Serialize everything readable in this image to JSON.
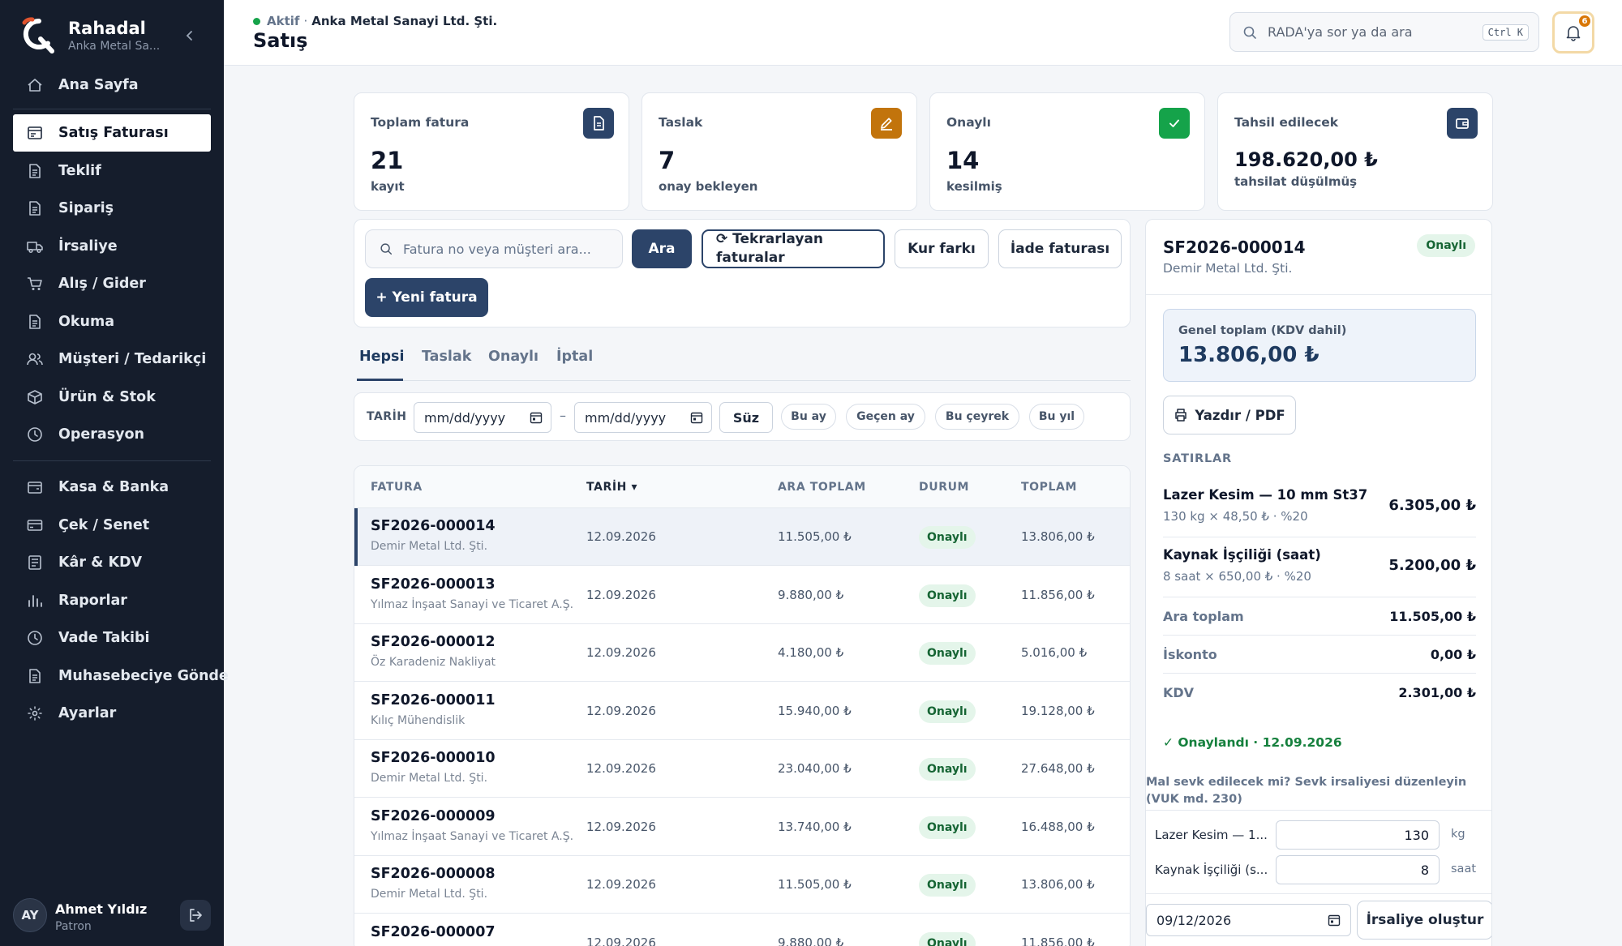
{
  "brand": {
    "name": "Rahadal",
    "subtitle": "Anka Metal Sa..."
  },
  "sidebar": {
    "items": [
      {
        "label": "Ana Sayfa",
        "icon": "home-icon"
      },
      {
        "label": "Satış Faturası",
        "icon": "invoice-icon",
        "active": true
      },
      {
        "label": "Teklif",
        "icon": "document-icon"
      },
      {
        "label": "Sipariş",
        "icon": "document-icon"
      },
      {
        "label": "İrsaliye",
        "icon": "truck-icon"
      },
      {
        "label": "Alış / Gider",
        "icon": "cart-icon"
      },
      {
        "label": "Okuma",
        "icon": "document-icon"
      },
      {
        "label": "Müşteri / Tedarikçi",
        "icon": "users-icon"
      },
      {
        "label": "Ürün & Stok",
        "icon": "box-icon"
      },
      {
        "label": "Operasyon",
        "icon": "clock-icon"
      },
      {
        "label": "Kasa & Banka",
        "icon": "cashbox-icon"
      },
      {
        "label": "Çek / Senet",
        "icon": "card-icon"
      },
      {
        "label": "Kâr & KDV",
        "icon": "ledger-icon"
      },
      {
        "label": "Raporlar",
        "icon": "bar-chart-icon"
      },
      {
        "label": "Vade Takibi",
        "icon": "clock-icon"
      },
      {
        "label": "Muhasebeciye Gönde",
        "icon": "document-icon"
      },
      {
        "label": "Ayarlar",
        "icon": "sun-gear-icon"
      }
    ]
  },
  "user": {
    "initials": "AY",
    "name": "Ahmet Yıldız",
    "role": "Patron"
  },
  "header": {
    "status": "Aktif",
    "separator": "·",
    "company": "Anka Metal Sanayi Ltd. Şti.",
    "title": "Satış",
    "search_placeholder": "RADA'ya sor ya da ara",
    "shortcut": "Ctrl K",
    "notification_count": "6"
  },
  "stats": [
    {
      "label": "Toplam fatura",
      "value": "21",
      "sub": "kayıt",
      "color": "#2c4469",
      "icon": "file-icon"
    },
    {
      "label": "Taslak",
      "value": "7",
      "sub": "onay bekleyen",
      "color": "#c2740c",
      "icon": "pencil-icon"
    },
    {
      "label": "Onaylı",
      "value": "14",
      "sub": "kesilmiş",
      "color": "#15a34a",
      "icon": "check-icon"
    },
    {
      "label": "Tahsil edilecek",
      "value": "198.620,00 ₺",
      "sub": "tahsilat düşülmüş",
      "color": "#2c4469",
      "icon": "wallet-icon"
    }
  ],
  "toolbar": {
    "search_placeholder": "Fatura no veya müşteri ara...",
    "search_button": "Ara",
    "recurring_line1": "⟳ Tekrarlayan",
    "recurring_line2": "faturalar",
    "fx_button": "Kur farkı",
    "return_button": "İade faturası",
    "new_button": "+ Yeni fatura"
  },
  "tabs": [
    "Hepsi",
    "Taslak",
    "Onaylı",
    "İptal"
  ],
  "filter": {
    "label": "TARİH",
    "date_placeholder": "mm/dd/yyyy",
    "dash": "–",
    "apply": "Süz",
    "chips": [
      "Bu ay",
      "Geçen ay",
      "Bu çeyrek",
      "Bu yıl"
    ]
  },
  "table": {
    "columns": [
      "FATURA",
      "TARİH ▾",
      "ARA TOPLAM",
      "DURUM",
      "TOPLAM"
    ],
    "rows": [
      {
        "no": "SF2026-000014",
        "customer": "Demir Metal Ltd. Şti.",
        "date": "12.09.2026",
        "subtotal": "11.505,00 ₺",
        "status": "Onaylı",
        "total": "13.806,00 ₺"
      },
      {
        "no": "SF2026-000013",
        "customer": "Yılmaz İnşaat Sanayi ve Ticaret A.Ş.",
        "date": "12.09.2026",
        "subtotal": "9.880,00 ₺",
        "status": "Onaylı",
        "total": "11.856,00 ₺"
      },
      {
        "no": "SF2026-000012",
        "customer": "Öz Karadeniz Nakliyat",
        "date": "12.09.2026",
        "subtotal": "4.180,00 ₺",
        "status": "Onaylı",
        "total": "5.016,00 ₺"
      },
      {
        "no": "SF2026-000011",
        "customer": "Kılıç Mühendislik",
        "date": "12.09.2026",
        "subtotal": "15.940,00 ₺",
        "status": "Onaylı",
        "total": "19.128,00 ₺"
      },
      {
        "no": "SF2026-000010",
        "customer": "Demir Metal Ltd. Şti.",
        "date": "12.09.2026",
        "subtotal": "23.040,00 ₺",
        "status": "Onaylı",
        "total": "27.648,00 ₺"
      },
      {
        "no": "SF2026-000009",
        "customer": "Yılmaz İnşaat Sanayi ve Ticaret A.Ş.",
        "date": "12.09.2026",
        "subtotal": "13.740,00 ₺",
        "status": "Onaylı",
        "total": "16.488,00 ₺"
      },
      {
        "no": "SF2026-000008",
        "customer": "Demir Metal Ltd. Şti.",
        "date": "12.09.2026",
        "subtotal": "11.505,00 ₺",
        "status": "Onaylı",
        "total": "13.806,00 ₺"
      },
      {
        "no": "SF2026-000007",
        "customer": "",
        "date": "12.09.2026",
        "subtotal": "9.880,00 ₺",
        "status": "Onaylı",
        "total": "11.856,00 ₺"
      }
    ]
  },
  "detail": {
    "no": "SF2026-000014",
    "customer": "Demir Metal Ltd. Şti.",
    "status": "Onaylı",
    "total_label": "Genel toplam (KDV dahil)",
    "total_value": "13.806,00 ₺",
    "print_button": "Yazdır / PDF",
    "lines_title": "SATIRLAR",
    "lines": [
      {
        "name": "Lazer Kesim — 10 mm St37",
        "detail": "130 kg × 48,50 ₺ · %20",
        "amount": "6.305,00 ₺"
      },
      {
        "name": "Kaynak İşçiliği (saat)",
        "detail": "8 saat × 650,00 ₺ · %20",
        "amount": "5.200,00 ₺"
      }
    ],
    "summary": [
      {
        "label": "Ara toplam",
        "value": "11.505,00 ₺"
      },
      {
        "label": "İskonto",
        "value": "0,00 ₺"
      },
      {
        "label": "KDV",
        "value": "2.301,00 ₺"
      }
    ],
    "approved": "✓ Onaylandı · 12.09.2026",
    "ship_question": "Mal sevk edilecek mi? Sevk irsaliyesi düzenleyin (VUK md. 230)",
    "ship_lines": [
      {
        "name": "Lazer Kesim — 1...",
        "qty": "130",
        "unit": "kg"
      },
      {
        "name": "Kaynak İşçiliği (s...",
        "qty": "8",
        "unit": "saat"
      }
    ],
    "ship_date": "09/12/2026",
    "ship_button": "İrsaliye oluştur"
  }
}
